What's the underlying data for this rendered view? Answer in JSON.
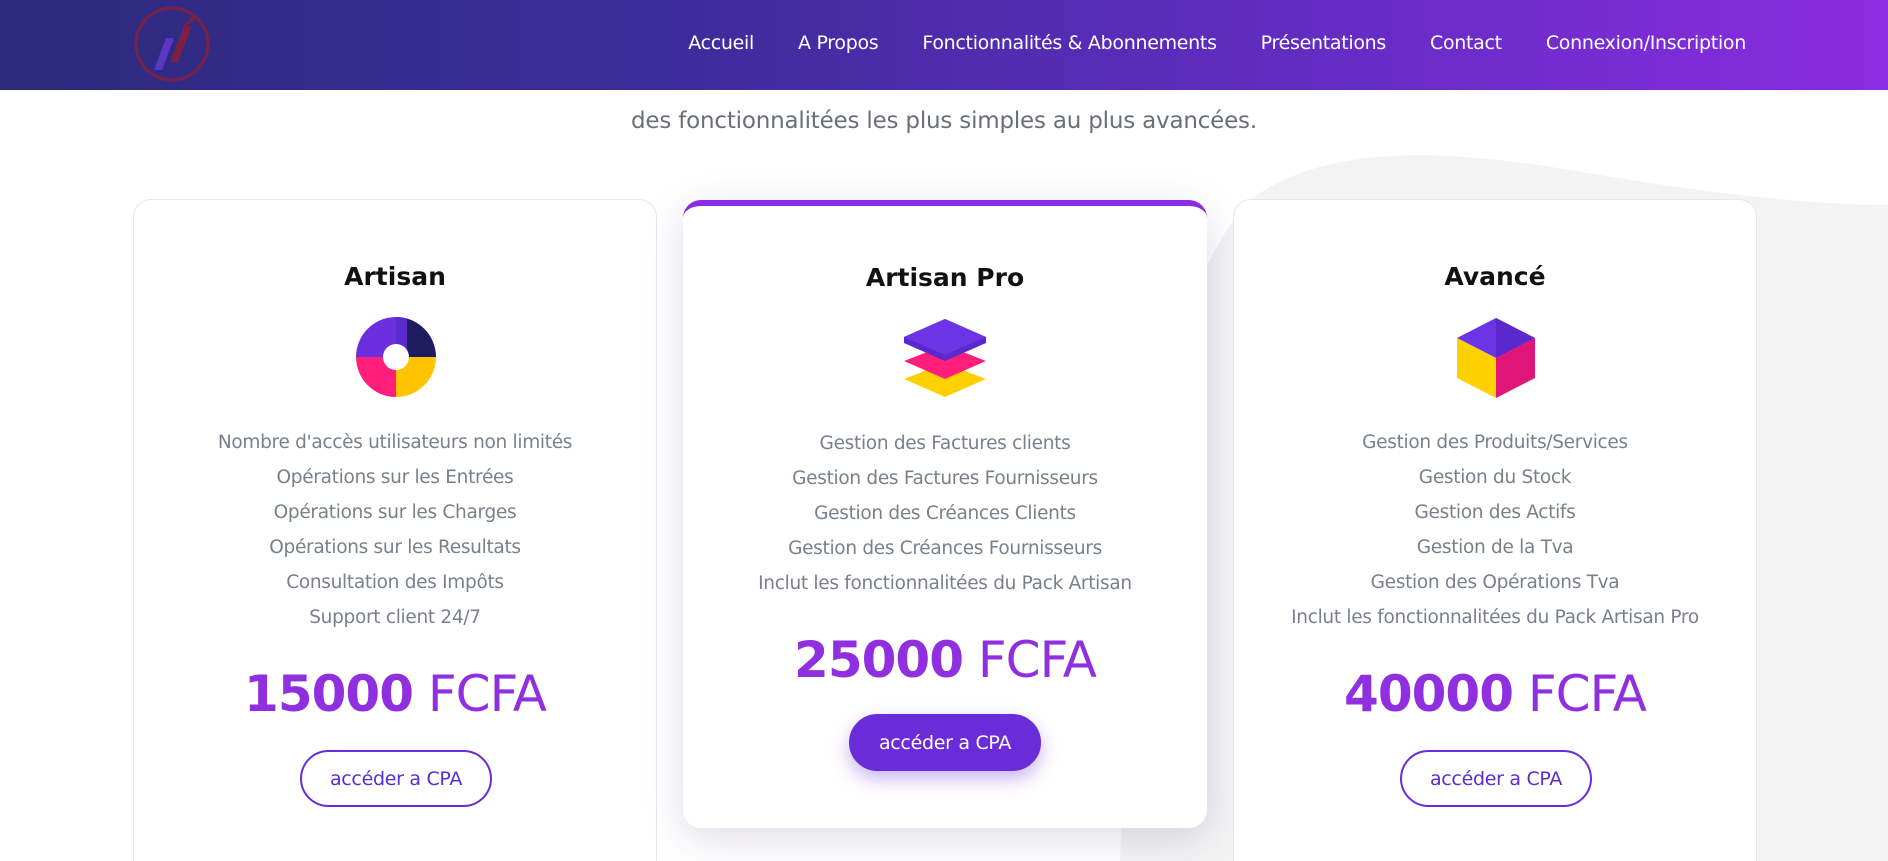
{
  "colors": {
    "header_start": "#2c2a7c",
    "header_end": "#8b2ce0",
    "accent": "#8f2fe0",
    "button": "#6a2cd8",
    "feature_text": "#7b7f8c"
  },
  "header": {
    "logo": "logo-icon",
    "nav": [
      "Accueil",
      "A Propos",
      "Fonctionnalités & Abonnements",
      "Présentations",
      "Contact",
      "Connexion/Inscription"
    ]
  },
  "subtitle": "des fonctionnalitées les plus simples au plus avancées.",
  "plans": [
    {
      "name": "Artisan",
      "icon": "pie-segments-icon",
      "features": [
        "Nombre d'accès utilisateurs non limités",
        "Opérations sur les Entrées",
        "Opérations sur les Charges",
        "Opérations sur les Resultats",
        "Consultation des Impôts",
        "Support client 24/7"
      ],
      "price": "15000",
      "currency": "FCFA",
      "button": "accéder a CPA"
    },
    {
      "name": "Artisan Pro",
      "icon": "stacked-layers-icon",
      "features": [
        "Gestion des Factures clients",
        "Gestion des Factures Fournisseurs",
        "Gestion des Créances Clients",
        "Gestion des Créances Fournisseurs",
        "Inclut les fonctionnalitées du Pack Artisan"
      ],
      "price": "25000",
      "currency": "FCFA",
      "button": "accéder a CPA"
    },
    {
      "name": "Avancé",
      "icon": "cube-icon",
      "features": [
        "Gestion des Produits/Services",
        "Gestion du Stock",
        "Gestion des Actifs",
        "Gestion de la Tva",
        "Gestion des Opérations Tva",
        "Inclut les fonctionnalitées du Pack Artisan Pro"
      ],
      "price": "40000",
      "currency": "FCFA",
      "button": "accéder a CPA"
    }
  ]
}
